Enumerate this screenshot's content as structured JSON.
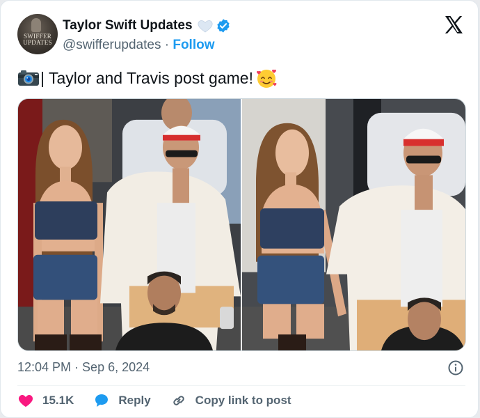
{
  "author": {
    "avatar_text": "SWIFFER UPDATES",
    "name": "Taylor Swift Updates",
    "handle": "@swifferupdates",
    "separator": "·",
    "follow_label": "Follow"
  },
  "tweet": {
    "text": "| Taylor and Travis post game!",
    "emoji_camera": "camera-emoji",
    "emoji_smile": "smiling-face-with-hearts-emoji"
  },
  "meta": {
    "time": "12:04 PM",
    "separator": " · ",
    "date": "Sep 6, 2024"
  },
  "actions": {
    "likes": "15.1K",
    "reply_label": "Reply",
    "copy_label": "Copy link to post"
  },
  "icons": {
    "x_logo": "x-logo-icon",
    "verified": "verified-badge-icon",
    "heart_badge": "white-heart-icon",
    "info": "info-icon"
  },
  "colors": {
    "accent": "#1d9bf0",
    "text": "#0f1419",
    "secondary": "#536471",
    "like": "#f91880"
  }
}
